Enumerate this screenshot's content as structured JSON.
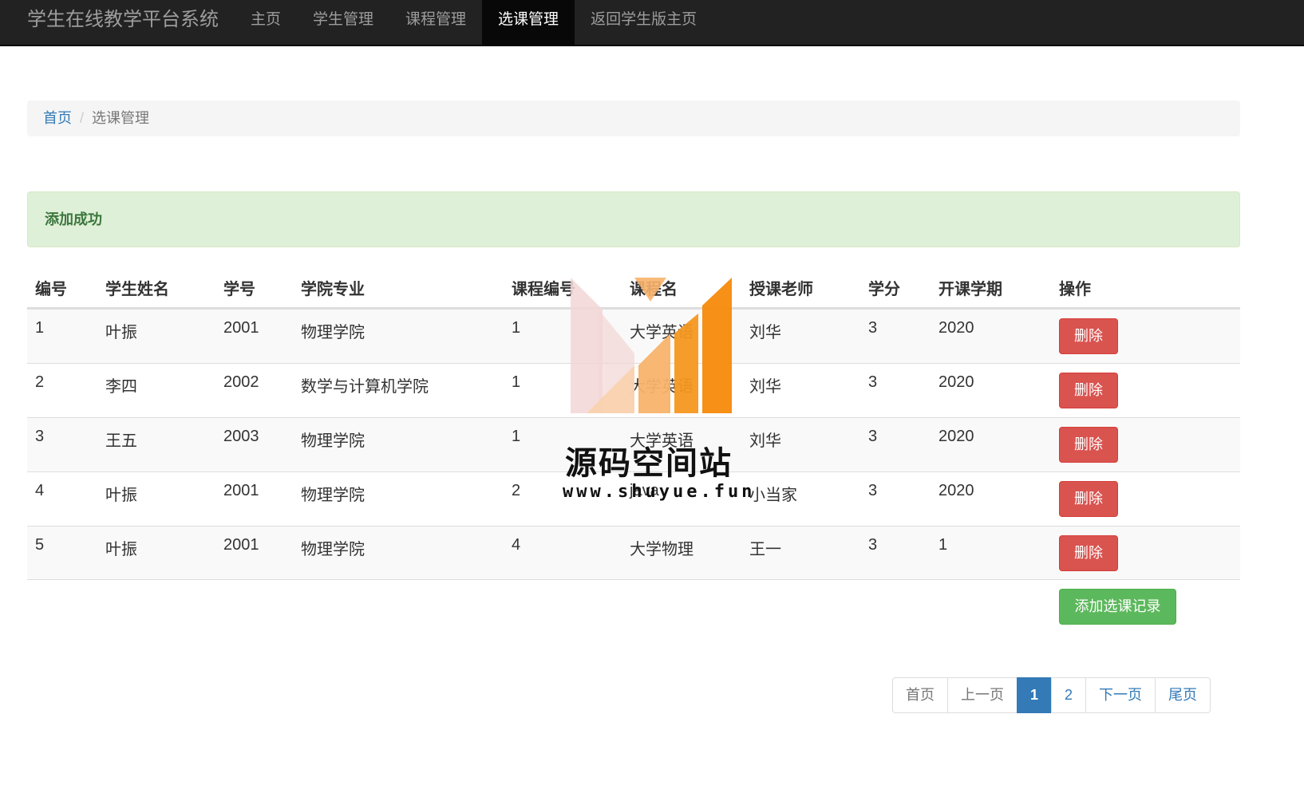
{
  "navbar": {
    "brand": "学生在线教学平台系统",
    "items": [
      {
        "label": "主页",
        "active": false
      },
      {
        "label": "学生管理",
        "active": false
      },
      {
        "label": "课程管理",
        "active": false
      },
      {
        "label": "选课管理",
        "active": true
      },
      {
        "label": "返回学生版主页",
        "active": false
      }
    ]
  },
  "breadcrumb": {
    "home": "首页",
    "separator": "/",
    "current": "选课管理"
  },
  "alert": {
    "message": "添加成功",
    "color": "#3c763d"
  },
  "table": {
    "headers": [
      "编号",
      "学生姓名",
      "学号",
      "学院专业",
      "课程编号",
      "课程名",
      "授课老师",
      "学分",
      "开课学期",
      "操作"
    ],
    "rows": [
      [
        "1",
        "叶振",
        "2001",
        "物理学院",
        "1",
        "大学英语",
        "刘华",
        "3",
        "2020"
      ],
      [
        "2",
        "李四",
        "2002",
        "数学与计算机学院",
        "1",
        "大学英语",
        "刘华",
        "3",
        "2020"
      ],
      [
        "3",
        "王五",
        "2003",
        "物理学院",
        "1",
        "大学英语",
        "刘华",
        "3",
        "2020"
      ],
      [
        "4",
        "叶振",
        "2001",
        "物理学院",
        "2",
        "java",
        "小当家",
        "3",
        "2020"
      ],
      [
        "5",
        "叶振",
        "2001",
        "物理学院",
        "4",
        "大学物理",
        "王一",
        "3",
        "1"
      ]
    ],
    "delete_label": "删除",
    "delete_color": "#d9534f"
  },
  "add_button": {
    "label": "添加选课记录",
    "color": "#5cb85c"
  },
  "pagination": {
    "first": "首页",
    "prev": "上一页",
    "pages": [
      "1",
      "2"
    ],
    "current": "1",
    "next": "下一页",
    "last": "尾页"
  },
  "watermark": {
    "title": "源码空间站",
    "url": "www.shuyue.fun"
  }
}
